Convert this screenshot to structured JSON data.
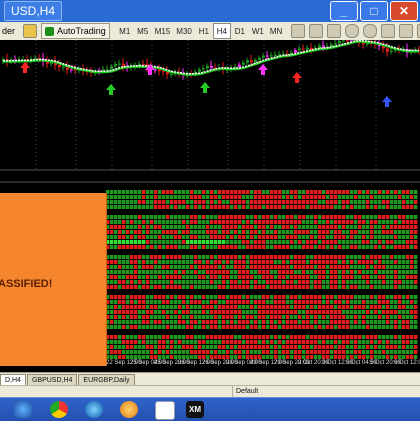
{
  "window": {
    "title": "USD,H4",
    "minimize_glyph": "_",
    "maximize_glyph": "□",
    "close_glyph": "✕"
  },
  "toolbar": {
    "left_fragment": "der",
    "autotrading_label": "AutoTrading",
    "timeframes": [
      "M1",
      "M5",
      "M15",
      "M30",
      "H1",
      "H4",
      "D1",
      "W1",
      "MN"
    ]
  },
  "indicator_overlay": {
    "text": "ASSIFIED!",
    "color": "#f6862d"
  },
  "time_axis": {
    "labels": [
      "22 Sep 12:00",
      "25 Sep 04:00",
      "25 Sep 20:00",
      "26 Sep 12:00",
      "26 Sep 20:00",
      "28 Sep 04:00",
      "29 Sep 12:00",
      "29 Sep 20:00",
      "2 Oct 20:00",
      "3 Oct 12:00",
      "5 Oct 04:00",
      "5 Oct 20:00",
      "6 Oct 12:00"
    ]
  },
  "tabs": [
    {
      "label": "D,H4",
      "active": true
    },
    {
      "label": "GBPUSD,H4",
      "active": false
    },
    {
      "label": "EURGBP,Daily",
      "active": false
    }
  ],
  "statusbar": {
    "profile": "Default"
  },
  "taskbar": {
    "icons": [
      "windows-start-icon",
      "chrome-icon",
      "globe-icon",
      "orange-app-icon",
      "document-icon",
      "xm-icon"
    ],
    "xm_label": "XM"
  },
  "colors": {
    "bullish": "#1e9b1e",
    "bearish": "#e31c1c",
    "bright_green": "#33e633",
    "ma_white": "#ffffff",
    "ma_green": "#1fd11f"
  }
}
